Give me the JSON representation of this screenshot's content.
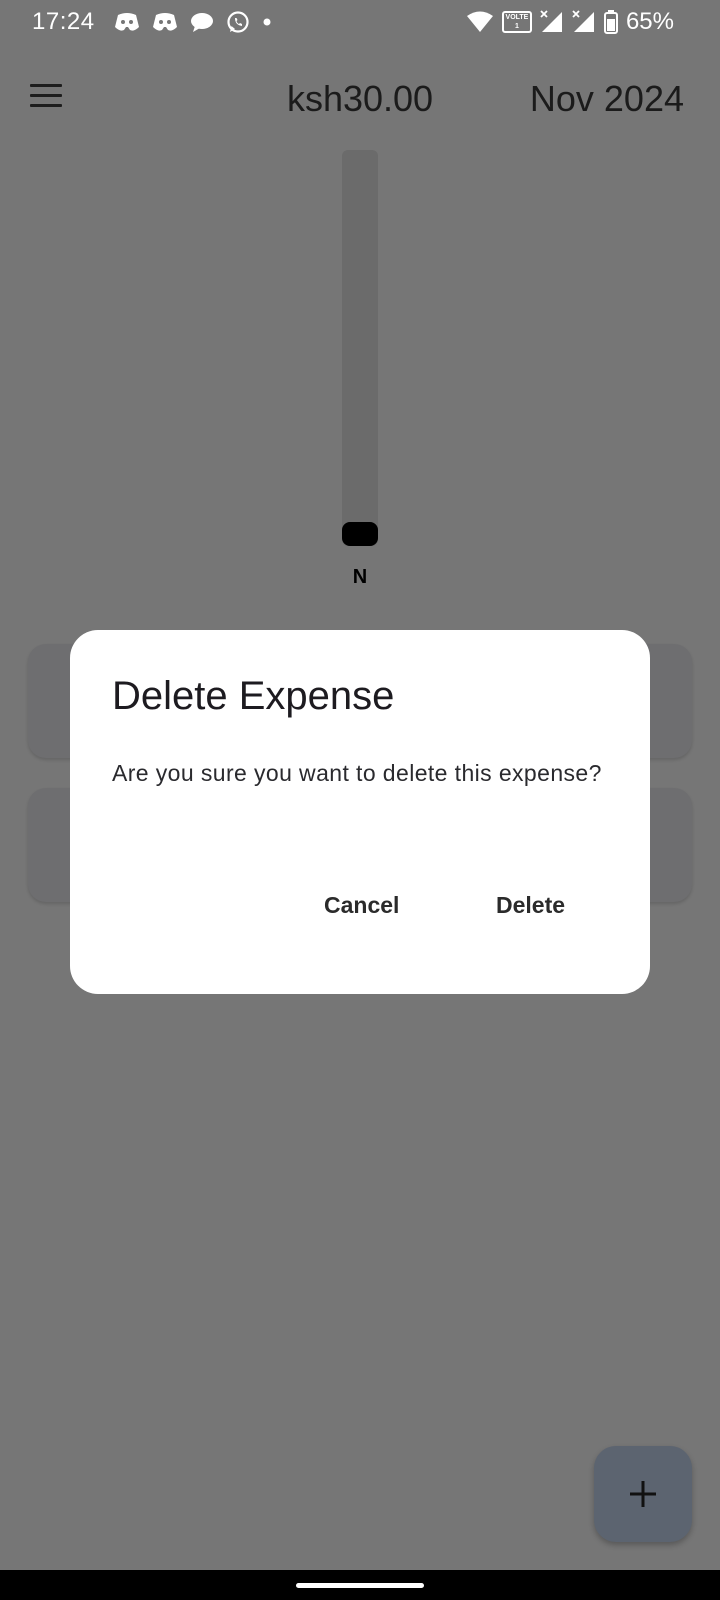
{
  "status_bar": {
    "time": "17:24",
    "battery": "65%",
    "volte_top": "VOLTE",
    "volte_bottom": "1",
    "notification_icons": [
      "discord-icon",
      "discord-icon",
      "chat-bubble-icon",
      "whatsapp-icon",
      "dot-icon"
    ],
    "system_icons": [
      "wifi-icon",
      "volte-icon",
      "signal-icon",
      "signal-icon",
      "battery-icon"
    ]
  },
  "app_bar": {
    "balance": "ksh30.00",
    "month": "Nov 2024",
    "menu_icon": "hamburger-menu-icon"
  },
  "chart_data": {
    "type": "bar",
    "categories": [
      "N"
    ],
    "values": [
      0.06
    ],
    "fill_fraction": 0.06,
    "colors": {
      "fill": "#000000",
      "track": "#6b6b6b"
    }
  },
  "dialog": {
    "title": "Delete Expense",
    "message": "Are you sure you want to delete this expense?",
    "cancel_label": "Cancel",
    "delete_label": "Delete"
  },
  "fab": {
    "icon": "plus-icon"
  },
  "colors": {
    "scrim_background": "#767676",
    "dialog_background": "#ffffff",
    "fab_background": "#5c6470"
  }
}
